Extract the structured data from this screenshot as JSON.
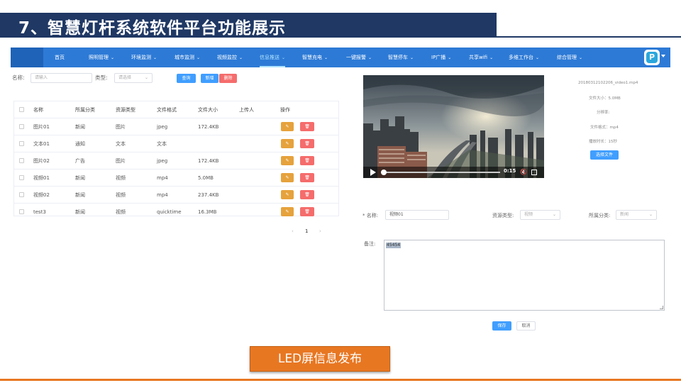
{
  "slide_title": "7、智慧灯杆系统软件平台功能展示",
  "nav": {
    "items": [
      "首页",
      "照明管理",
      "环境监测",
      "城市监测",
      "视频监控",
      "信息推送",
      "智慧充电",
      "一键报警",
      "智慧停车",
      "IP广播",
      "共享wifi",
      "多维工作台",
      "综合管理"
    ],
    "active": "信息推送",
    "app_icon_letter": "P"
  },
  "search": {
    "name_label": "名称:",
    "name_placeholder": "请输入",
    "type_label": "类型:",
    "type_placeholder": "请选择",
    "query_button": "查询",
    "add_button": "新增",
    "delete_button": "删除"
  },
  "table": {
    "headers": [
      "名称",
      "所属分类",
      "资源类型",
      "文件格式",
      "文件大小",
      "上传人",
      "操作"
    ],
    "rows": [
      [
        "图片01",
        "新闻",
        "图片",
        "jpeg",
        "172.4KB",
        ""
      ],
      [
        "文本01",
        "通知",
        "文本",
        "文本",
        "",
        ""
      ],
      [
        "图片02",
        "广告",
        "图片",
        "jpeg",
        "172.4KB",
        ""
      ],
      [
        "视频01",
        "新闻",
        "视频",
        "mp4",
        "5.0MB",
        ""
      ],
      [
        "视频02",
        "新闻",
        "视频",
        "mp4",
        "237.4KB",
        ""
      ],
      [
        "test3",
        "新闻",
        "视频",
        "quicktime",
        "16.3MB",
        ""
      ]
    ],
    "edit_icon": "edit-icon",
    "delete_icon": "trash-icon"
  },
  "pagination": {
    "prev": "‹",
    "current": "1",
    "next": "›"
  },
  "video": {
    "time": "0:15",
    "progress": 0.01
  },
  "file_info": {
    "filename": "20180312102206_video1.mp4",
    "size": "文件大小：5.0MB",
    "resolution": "分辨率:",
    "format": "文件格式：mp4",
    "duration": "播放时长：15秒",
    "choose_button": "选择文件"
  },
  "form": {
    "name_label": "* 名称:",
    "name_value": "视频01",
    "resource_type_label": "资源类型:",
    "resource_type_value": "视频",
    "category_label": "所属分类:",
    "category_value": "新闻",
    "remark_label": "备注:",
    "remark_value": "45454",
    "save_button": "保存",
    "cancel_button": "取消"
  },
  "footer_button": "LED屏信息发布",
  "colors": {
    "title_bar": "#1f3864",
    "nav_bar": "#2d7ad6",
    "primary": "#409eff",
    "danger": "#f56c6c",
    "warning": "#e6a23c",
    "accent_orange": "#e87722"
  }
}
